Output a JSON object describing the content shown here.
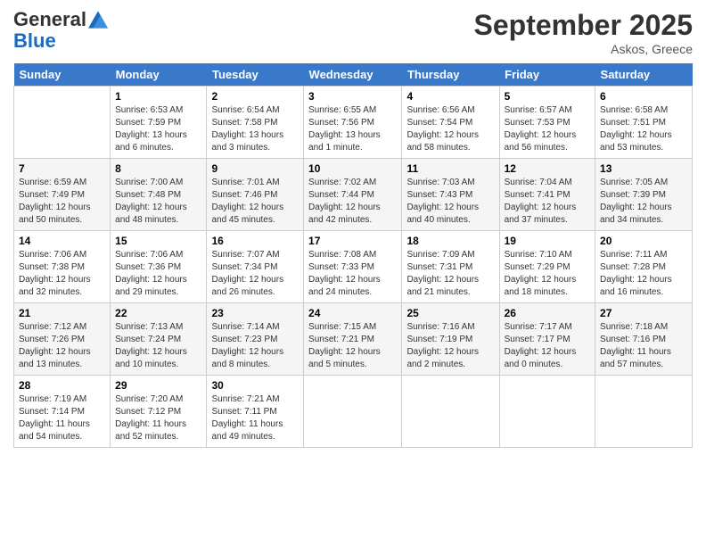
{
  "logo": {
    "line1": "General",
    "line2": "Blue"
  },
  "title": "September 2025",
  "subtitle": "Askos, Greece",
  "days_of_week": [
    "Sunday",
    "Monday",
    "Tuesday",
    "Wednesday",
    "Thursday",
    "Friday",
    "Saturday"
  ],
  "weeks": [
    [
      {
        "day": "",
        "sunrise": "",
        "sunset": "",
        "daylight": ""
      },
      {
        "day": "1",
        "sunrise": "Sunrise: 6:53 AM",
        "sunset": "Sunset: 7:59 PM",
        "daylight": "Daylight: 13 hours and 6 minutes."
      },
      {
        "day": "2",
        "sunrise": "Sunrise: 6:54 AM",
        "sunset": "Sunset: 7:58 PM",
        "daylight": "Daylight: 13 hours and 3 minutes."
      },
      {
        "day": "3",
        "sunrise": "Sunrise: 6:55 AM",
        "sunset": "Sunset: 7:56 PM",
        "daylight": "Daylight: 13 hours and 1 minute."
      },
      {
        "day": "4",
        "sunrise": "Sunrise: 6:56 AM",
        "sunset": "Sunset: 7:54 PM",
        "daylight": "Daylight: 12 hours and 58 minutes."
      },
      {
        "day": "5",
        "sunrise": "Sunrise: 6:57 AM",
        "sunset": "Sunset: 7:53 PM",
        "daylight": "Daylight: 12 hours and 56 minutes."
      },
      {
        "day": "6",
        "sunrise": "Sunrise: 6:58 AM",
        "sunset": "Sunset: 7:51 PM",
        "daylight": "Daylight: 12 hours and 53 minutes."
      }
    ],
    [
      {
        "day": "7",
        "sunrise": "Sunrise: 6:59 AM",
        "sunset": "Sunset: 7:49 PM",
        "daylight": "Daylight: 12 hours and 50 minutes."
      },
      {
        "day": "8",
        "sunrise": "Sunrise: 7:00 AM",
        "sunset": "Sunset: 7:48 PM",
        "daylight": "Daylight: 12 hours and 48 minutes."
      },
      {
        "day": "9",
        "sunrise": "Sunrise: 7:01 AM",
        "sunset": "Sunset: 7:46 PM",
        "daylight": "Daylight: 12 hours and 45 minutes."
      },
      {
        "day": "10",
        "sunrise": "Sunrise: 7:02 AM",
        "sunset": "Sunset: 7:44 PM",
        "daylight": "Daylight: 12 hours and 42 minutes."
      },
      {
        "day": "11",
        "sunrise": "Sunrise: 7:03 AM",
        "sunset": "Sunset: 7:43 PM",
        "daylight": "Daylight: 12 hours and 40 minutes."
      },
      {
        "day": "12",
        "sunrise": "Sunrise: 7:04 AM",
        "sunset": "Sunset: 7:41 PM",
        "daylight": "Daylight: 12 hours and 37 minutes."
      },
      {
        "day": "13",
        "sunrise": "Sunrise: 7:05 AM",
        "sunset": "Sunset: 7:39 PM",
        "daylight": "Daylight: 12 hours and 34 minutes."
      }
    ],
    [
      {
        "day": "14",
        "sunrise": "Sunrise: 7:06 AM",
        "sunset": "Sunset: 7:38 PM",
        "daylight": "Daylight: 12 hours and 32 minutes."
      },
      {
        "day": "15",
        "sunrise": "Sunrise: 7:06 AM",
        "sunset": "Sunset: 7:36 PM",
        "daylight": "Daylight: 12 hours and 29 minutes."
      },
      {
        "day": "16",
        "sunrise": "Sunrise: 7:07 AM",
        "sunset": "Sunset: 7:34 PM",
        "daylight": "Daylight: 12 hours and 26 minutes."
      },
      {
        "day": "17",
        "sunrise": "Sunrise: 7:08 AM",
        "sunset": "Sunset: 7:33 PM",
        "daylight": "Daylight: 12 hours and 24 minutes."
      },
      {
        "day": "18",
        "sunrise": "Sunrise: 7:09 AM",
        "sunset": "Sunset: 7:31 PM",
        "daylight": "Daylight: 12 hours and 21 minutes."
      },
      {
        "day": "19",
        "sunrise": "Sunrise: 7:10 AM",
        "sunset": "Sunset: 7:29 PM",
        "daylight": "Daylight: 12 hours and 18 minutes."
      },
      {
        "day": "20",
        "sunrise": "Sunrise: 7:11 AM",
        "sunset": "Sunset: 7:28 PM",
        "daylight": "Daylight: 12 hours and 16 minutes."
      }
    ],
    [
      {
        "day": "21",
        "sunrise": "Sunrise: 7:12 AM",
        "sunset": "Sunset: 7:26 PM",
        "daylight": "Daylight: 12 hours and 13 minutes."
      },
      {
        "day": "22",
        "sunrise": "Sunrise: 7:13 AM",
        "sunset": "Sunset: 7:24 PM",
        "daylight": "Daylight: 12 hours and 10 minutes."
      },
      {
        "day": "23",
        "sunrise": "Sunrise: 7:14 AM",
        "sunset": "Sunset: 7:23 PM",
        "daylight": "Daylight: 12 hours and 8 minutes."
      },
      {
        "day": "24",
        "sunrise": "Sunrise: 7:15 AM",
        "sunset": "Sunset: 7:21 PM",
        "daylight": "Daylight: 12 hours and 5 minutes."
      },
      {
        "day": "25",
        "sunrise": "Sunrise: 7:16 AM",
        "sunset": "Sunset: 7:19 PM",
        "daylight": "Daylight: 12 hours and 2 minutes."
      },
      {
        "day": "26",
        "sunrise": "Sunrise: 7:17 AM",
        "sunset": "Sunset: 7:17 PM",
        "daylight": "Daylight: 12 hours and 0 minutes."
      },
      {
        "day": "27",
        "sunrise": "Sunrise: 7:18 AM",
        "sunset": "Sunset: 7:16 PM",
        "daylight": "Daylight: 11 hours and 57 minutes."
      }
    ],
    [
      {
        "day": "28",
        "sunrise": "Sunrise: 7:19 AM",
        "sunset": "Sunset: 7:14 PM",
        "daylight": "Daylight: 11 hours and 54 minutes."
      },
      {
        "day": "29",
        "sunrise": "Sunrise: 7:20 AM",
        "sunset": "Sunset: 7:12 PM",
        "daylight": "Daylight: 11 hours and 52 minutes."
      },
      {
        "day": "30",
        "sunrise": "Sunrise: 7:21 AM",
        "sunset": "Sunset: 7:11 PM",
        "daylight": "Daylight: 11 hours and 49 minutes."
      },
      {
        "day": "",
        "sunrise": "",
        "sunset": "",
        "daylight": ""
      },
      {
        "day": "",
        "sunrise": "",
        "sunset": "",
        "daylight": ""
      },
      {
        "day": "",
        "sunrise": "",
        "sunset": "",
        "daylight": ""
      },
      {
        "day": "",
        "sunrise": "",
        "sunset": "",
        "daylight": ""
      }
    ]
  ]
}
